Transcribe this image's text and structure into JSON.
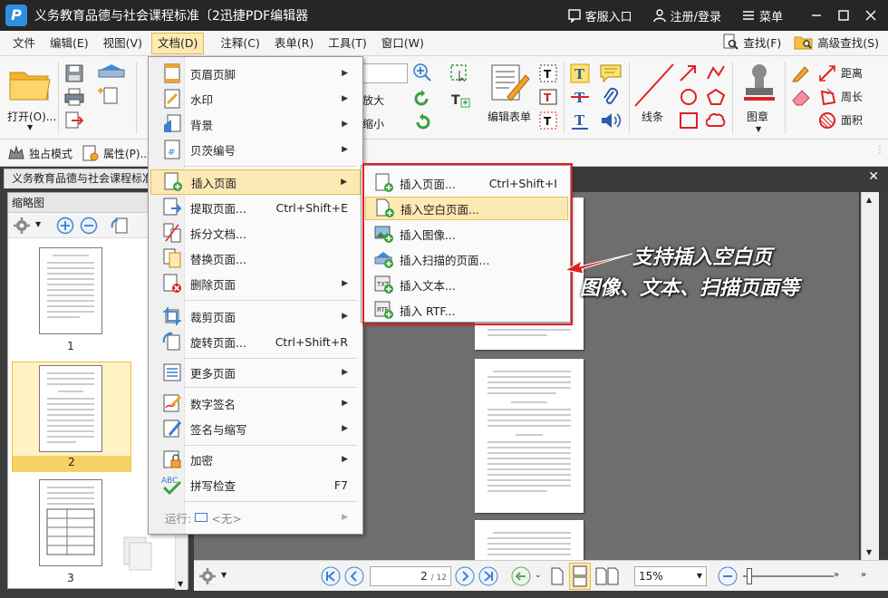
{
  "app": {
    "logo_letter": "P",
    "title": "义务教育品德与社会课程标准〔2迅捷PDF编辑器",
    "service": "客服入口",
    "login": "注册/登录",
    "menu": "菜单"
  },
  "menubar": {
    "items": [
      "文件",
      "编辑(E)",
      "视图(V)",
      "文档(D)",
      "注释(C)",
      "表单(R)",
      "工具(T)",
      "窗口(W)"
    ],
    "find": "查找(F)",
    "advanced_find": "高级查找(S)"
  },
  "ribbon": {
    "open": "打开(O)...",
    "zoom_in_label": "放大",
    "zoom_out_label": "缩小",
    "edit_form": "编辑表单",
    "lines": "线条",
    "stamp": "图章",
    "distance": "距离",
    "perimeter": "周长",
    "area": "面积"
  },
  "subbar": {
    "exclusive": "独占模式",
    "properties": "属性(P)..."
  },
  "tab": {
    "doc_name": "义务教育品德与社会课程标准"
  },
  "thumbnails": {
    "title": "缩略图",
    "pages": [
      "1",
      "2",
      "3"
    ],
    "selected": "2"
  },
  "document_menu": {
    "items": [
      {
        "label": "页眉页脚",
        "shortcut": "",
        "submenu": true
      },
      {
        "label": "水印",
        "shortcut": "",
        "submenu": true
      },
      {
        "label": "背景",
        "shortcut": "",
        "submenu": true
      },
      {
        "label": "贝茨编号",
        "shortcut": "",
        "submenu": true
      },
      {
        "label": "插入页面",
        "shortcut": "",
        "submenu": true
      },
      {
        "label": "提取页面...",
        "shortcut": "Ctrl+Shift+E",
        "submenu": false
      },
      {
        "label": "拆分文档...",
        "shortcut": "",
        "submenu": false
      },
      {
        "label": "替换页面...",
        "shortcut": "",
        "submenu": false
      },
      {
        "label": "删除页面",
        "shortcut": "",
        "submenu": true
      },
      {
        "label": "裁剪页面",
        "shortcut": "",
        "submenu": true
      },
      {
        "label": "旋转页面...",
        "shortcut": "Ctrl+Shift+R",
        "submenu": false
      },
      {
        "label": "更多页面",
        "shortcut": "",
        "submenu": true
      },
      {
        "label": "数字签名",
        "shortcut": "",
        "submenu": true
      },
      {
        "label": "签名与缩写",
        "shortcut": "",
        "submenu": true
      },
      {
        "label": "加密",
        "shortcut": "",
        "submenu": true
      },
      {
        "label": "拼写检查",
        "shortcut": "F7",
        "submenu": false
      }
    ],
    "run_label": "运行:",
    "run_value": "<无>"
  },
  "insert_submenu": {
    "items": [
      {
        "label": "插入页面...",
        "shortcut": "Ctrl+Shift+I"
      },
      {
        "label": "插入空白页面...",
        "shortcut": ""
      },
      {
        "label": "插入图像...",
        "shortcut": ""
      },
      {
        "label": "插入扫描的页面...",
        "shortcut": ""
      },
      {
        "label": "插入文本...",
        "shortcut": ""
      },
      {
        "label": "插入 RTF...",
        "shortcut": ""
      }
    ],
    "highlighted": "插入空白页面..."
  },
  "callout": {
    "line1": "支持插入空白页",
    "line2": "图像、文本、扫描页面等"
  },
  "status": {
    "page_current": "2",
    "page_total": "/ 12",
    "zoom": "15%"
  },
  "colors": {
    "titlebar": "#262626",
    "highlight": "#fde9b3",
    "accent_red": "#e02020",
    "logo_blue": "#2d8fe0"
  }
}
